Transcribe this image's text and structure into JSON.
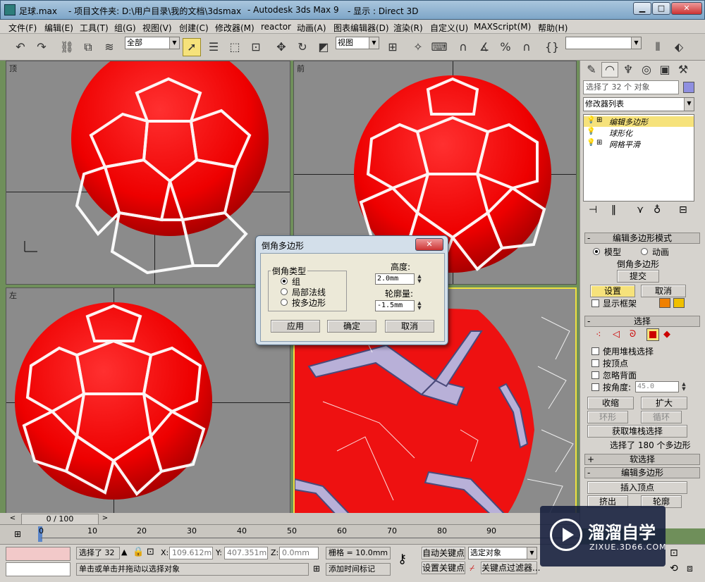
{
  "titlebar": {
    "file": "足球.max",
    "project_label": "- 项目文件夹: D:\\用户目录\\我的文档\\3dsmax",
    "app": "- Autodesk 3ds Max 9",
    "display": "- 显示 : Direct 3D"
  },
  "menu": [
    "文件(F)",
    "编辑(E)",
    "工具(T)",
    "组(G)",
    "视图(V)",
    "创建(C)",
    "修改器(M)",
    "reactor",
    "动画(A)",
    "图表编辑器(D)",
    "渲染(R)",
    "自定义(U)",
    "MAXScript(M)",
    "帮助(H)"
  ],
  "toolbar": {
    "selection_filter": "全部",
    "ref_coord": "视图"
  },
  "viewports": {
    "top": "顶",
    "front": "前",
    "left": "左"
  },
  "command_panel": {
    "selected_info": "选择了 32 个 对象",
    "modifier_list": "修改器列表",
    "stack": [
      "编辑多边形",
      "球形化",
      "网格平滑"
    ],
    "rollout_edit_poly_mode": "编辑多边形模式",
    "mode_model": "模型",
    "mode_anim": "动画",
    "bevel_label": "倒角多边形",
    "commit": "提交",
    "settings": "设置",
    "cancel": "取消",
    "show_cage": "显示框架",
    "rollout_selection": "选择",
    "use_stack_sel": "使用堆栈选择",
    "by_vertex": "按顶点",
    "ignore_backface": "忽略背面",
    "by_angle": "按角度:",
    "angle_value": "45.0",
    "shrink": "收缩",
    "grow": "扩大",
    "ring": "环形",
    "loop": "循环",
    "get_stack_sel": "获取堆栈选择",
    "sel_status": "选择了 180 个多边形",
    "rollout_soft_sel": "软选择",
    "rollout_edit_polygons": "编辑多边形",
    "insert_vertex": "插入顶点",
    "extrude": "挤出",
    "outline": "轮廓"
  },
  "dialog": {
    "title": "倒角多边形",
    "group_title": "倒角类型",
    "opt_group": "组",
    "opt_local_normal": "局部法线",
    "opt_by_polygon": "按多边形",
    "height_label": "高度:",
    "height_value": "2.0mm",
    "outline_label": "轮廓量:",
    "outline_value": "-1.5mm",
    "apply": "应用",
    "ok": "确定",
    "cancel": "取消"
  },
  "timeline": {
    "frame_display": "0 / 100",
    "ticks": [
      "0",
      "10",
      "20",
      "30",
      "40",
      "50",
      "60",
      "70",
      "80",
      "90"
    ]
  },
  "status": {
    "selected": "选择了 32",
    "x_label": "X:",
    "x_value": "109.612mm",
    "y_label": "Y:",
    "y_value": "407.351mm",
    "z_label": "Z:",
    "z_value": "0.0mm",
    "grid": "栅格 = 10.0mm",
    "auto_key": "自动关键点",
    "selected_object": "选定对象",
    "set_key": "设置关键点",
    "key_filters": "关键点过滤器...",
    "prompt": "单击或单击并拖动以选择对象",
    "add_time_tag": "添加时间标记"
  },
  "watermark": {
    "brand": "溜溜自学",
    "url": "ZIXUE.3D66.COM"
  },
  "colors": {
    "ball_red": "#ee1111",
    "seam_white": "#ffffff",
    "selection_yellow": "#f6e27b",
    "viewport_gray": "#8b8b8b"
  }
}
